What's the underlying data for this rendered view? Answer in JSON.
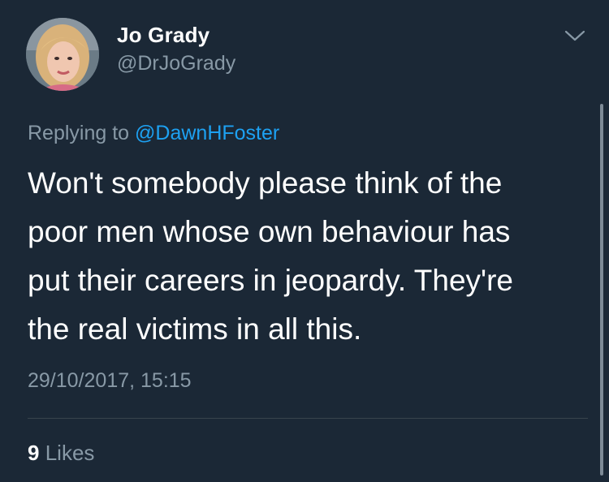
{
  "author": {
    "display_name": "Jo Grady",
    "handle": "@DrJoGrady"
  },
  "reply": {
    "prefix": "Replying to",
    "mention": "@DawnHFoster"
  },
  "tweet": {
    "text_lines": [
      "Won't somebody please think of the",
      "poor men whose own behaviour has",
      "put their careers in jeopardy. They're",
      "the real victims in all this."
    ],
    "timestamp": "29/10/2017, 15:15"
  },
  "stats": {
    "likes_count": "9",
    "likes_label": "Likes"
  },
  "icons": {
    "menu": "chevron-down-icon"
  },
  "colors": {
    "background": "#1b2836",
    "primary_text": "#ffffff",
    "secondary_text": "#8899a6",
    "link": "#1da1f2"
  }
}
